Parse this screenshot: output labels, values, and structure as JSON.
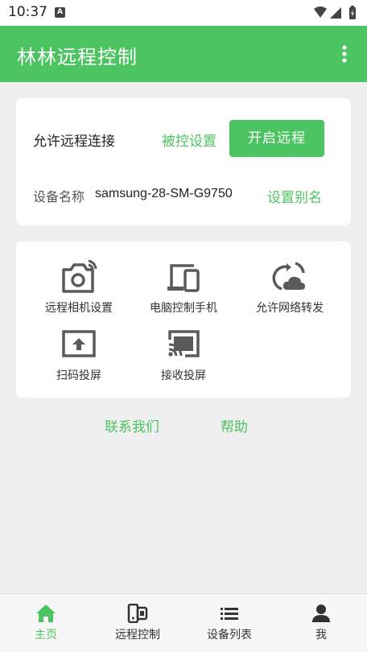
{
  "status_bar": {
    "time": "10:37",
    "notification_icon_letter": "A"
  },
  "app_bar": {
    "title": "林林远程控制",
    "menu_icon": "more-vert-icon"
  },
  "remote_card": {
    "allow_label": "允许远程连接",
    "controlled_settings": "被控设置",
    "start_button": "开启远程",
    "device_name_label": "设备名称",
    "device_name": "samsung-28-SM-G9750",
    "set_alias": "设置别名"
  },
  "features": [
    {
      "label": "远程相机设置",
      "icon": "camera-icon"
    },
    {
      "label": "电脑控制手机",
      "icon": "devices-icon"
    },
    {
      "label": "允许网络转发",
      "icon": "cloud-sync-icon"
    },
    {
      "label": "扫码投屏",
      "icon": "upload-screen-icon"
    },
    {
      "label": "接收投屏",
      "icon": "cast-icon"
    }
  ],
  "links": {
    "contact": "联系我们",
    "help": "帮助"
  },
  "tabs": [
    {
      "label": "主页",
      "icon": "home-icon",
      "active": true
    },
    {
      "label": "远程控制",
      "icon": "remote-control-icon",
      "active": false
    },
    {
      "label": "设备列表",
      "icon": "list-icon",
      "active": false
    },
    {
      "label": "我",
      "icon": "person-icon",
      "active": false
    }
  ],
  "colors": {
    "accent": "#4cc462",
    "background": "#efefef",
    "card": "#ffffff",
    "icon": "#5a5a5a"
  }
}
